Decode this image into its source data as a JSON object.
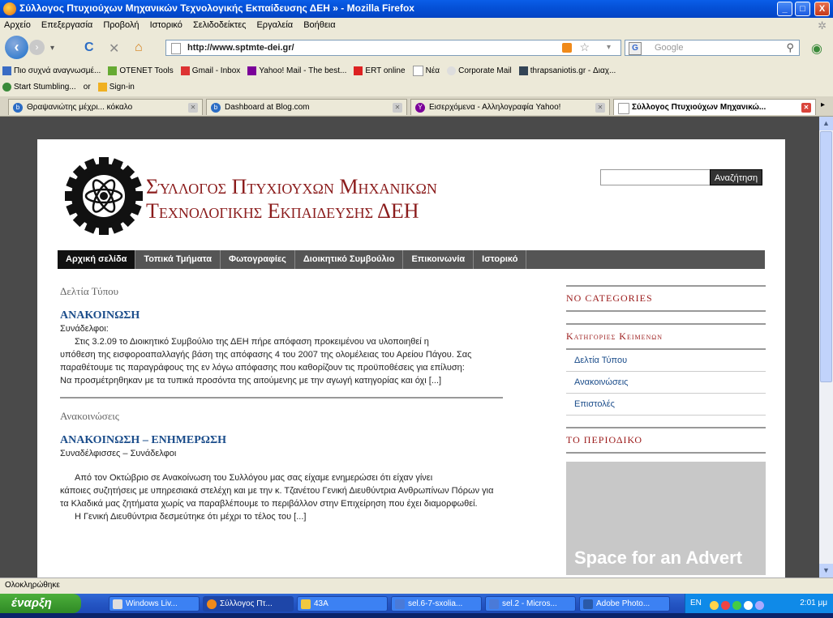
{
  "window": {
    "title": "Σύλλογος Πτυχιούχων Μηχανικών Τεχνολογικής Εκπαίδευσης ΔΕΗ » - Mozilla Firefox",
    "min": "_",
    "max": "□",
    "close": "X"
  },
  "menu": [
    "Αρχείο",
    "Επεξεργασία",
    "Προβολή",
    "Ιστορικό",
    "Σελιδοδείκτες",
    "Εργαλεία",
    "Βοήθεια"
  ],
  "nav": {
    "url": "http://www.sptmte-dei.gr/",
    "search_placeholder": "Google"
  },
  "bookmarks": [
    "Πιο συχνά αναγνωσμέ...",
    "OTENET Tools",
    "Gmail - Inbox",
    "Yahoo! Mail - The best...",
    "ERT online",
    "Νέα",
    "Corporate Mail",
    "thrapsaniotis.gr - Διαχ..."
  ],
  "toolbar2": {
    "stumble": "Start Stumbling...",
    "or": "or",
    "signin": "Sign-in"
  },
  "tabs": [
    "Θραψανιώτης μέχρι... κόκαλο",
    "Dashboard at Blog.com",
    "Εισερχόμενα - Αλληλογραφία Yahoo!",
    "Σύλλογος Πτυχιούχων Μηχανικώ..."
  ],
  "site": {
    "name_line1": "Σύλλογος Πτυχιουχων Μηχανικων",
    "name_line2": "Τεχνολογικης Εκπαιδευσης ΔΕΗ",
    "search_button": "Αναζήτηση",
    "nav": [
      "Αρχική σελίδα",
      "Τοπικά Τμήματα",
      "Φωτογραφίες",
      "Διοικητικό Συμβούλιο",
      "Επικοινωνία",
      "Ιστορικό"
    ]
  },
  "content": {
    "section1": "Δελτία Τύπου",
    "post1_title": "ΑΝΑΚΟΙΝΩΣΗ",
    "post1_greeting": "Συνάδελφοι:",
    "post1_para1_first": "Στις 3.2.09 το Διοικητικό Συμβούλιο της ΔΕΗ πήρε απόφαση προκειμένου να υλοποιηθεί η",
    "post1_para1_rest": "υπόθεση της εισφοροαπαλλαγής βάση της απόφασης 4 του 2007 της ολομέλειας του Αρείου Πάγου. Σας παραθέτουμε τις παραγράφους της εν λόγω απόφασης που καθορίζουν τις προϋποθέσεις για επίλυση:",
    "post1_para2": "Να προσμέτρηθηκαν με τα τυπικά προσόντα της αιτούμενης με την αγωγή κατηγορίας και όχι [...]",
    "section2": "Ανακοινώσεις",
    "post2_title": "ΑΝΑΚΟΙΝΩΣΗ – ΕΝΗΜΕΡΩΣΗ",
    "post2_greeting": "Συναδέλφισσες – Συνάδελφοι",
    "post2_para1_first": "Από τον Οκτώβριο σε Ανακοίνωση του Συλλόγου μας σας είχαμε ενημερώσει ότι είχαν γίνει",
    "post2_para1_rest": "κάποιες συζητήσεις με υπηρεσιακά στελέχη και με την κ. Τζανέτου Γενική Διευθύντρια Ανθρωπίνων Πόρων για τα Κλαδικά μας ζητήματα χωρίς να παραβλέπουμε το περιβάλλον στην Επιχείρηση που έχει διαμορφωθεί.",
    "post2_para2": "Η Γενική Διευθύντρια δεσμεύτηκε ότι μέχρι το τέλος του [...]"
  },
  "sidebar": {
    "widget1": "NO CATEGORIES",
    "widget2": "Κατηγοριεσ Κειμενων",
    "categories": [
      "Δελτία Τύπου",
      "Ανακοινώσεις",
      "Επιστολές"
    ],
    "widget3": "ΤΟ ΠΕΡΙΟΔΙΚΟ",
    "advert": "Space for an Advert"
  },
  "status": "Ολοκληρώθηκε",
  "taskbar": {
    "start": "έναρξη",
    "tasks": [
      "Windows Liv...",
      "Σύλλογος Πτ...",
      "43A",
      "sel.6-7-sxolia...",
      "sel.2 - Micros...",
      "Adobe Photo..."
    ],
    "lang": "EN",
    "clock": "2:01 μμ"
  },
  "colors": {
    "site_title": "#8b1c1c",
    "post_title": "#1a4c8a",
    "nav_bg": "#555555",
    "nav_active": "#111111"
  }
}
